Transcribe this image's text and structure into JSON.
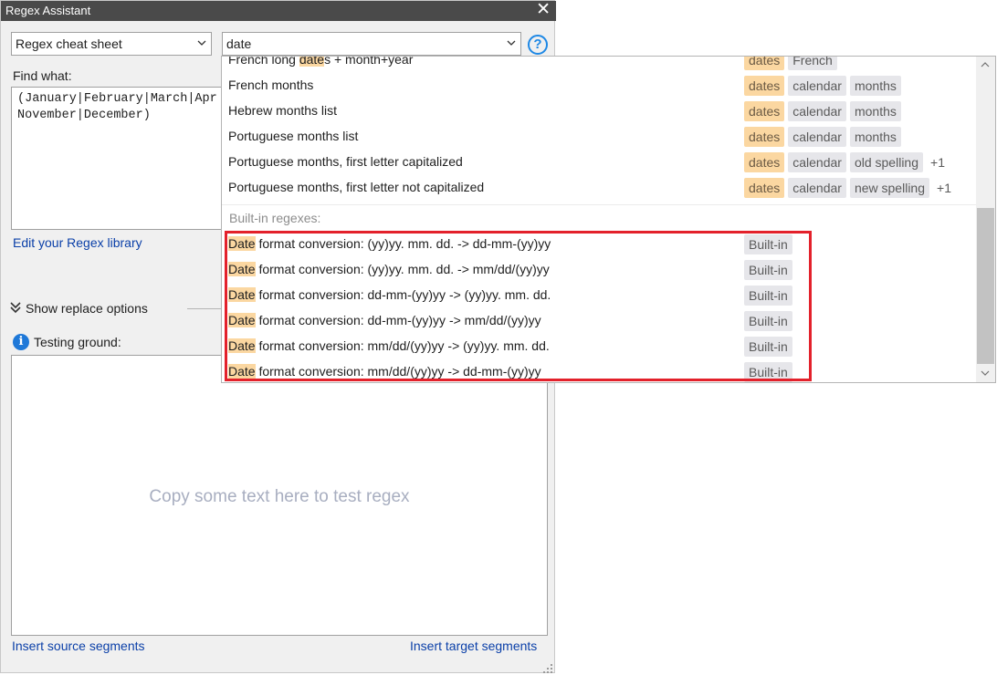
{
  "window": {
    "title": "Regex Assistant"
  },
  "library_select": {
    "value": "Regex cheat sheet"
  },
  "search": {
    "value": "date"
  },
  "find_what": {
    "label": "Find what:",
    "lines": [
      "(January|February|March|Apr",
      "November|December)"
    ]
  },
  "links": {
    "edit_library": "Edit your Regex library",
    "insert_source": "Insert source segments",
    "insert_target": "Insert target segments"
  },
  "replace_toggle": {
    "label": "Show replace options"
  },
  "testing": {
    "label": "Testing ground:",
    "placeholder": "Copy some text here to test regex"
  },
  "dropdown": {
    "partial_row": {
      "pre": "French long ",
      "match": "date",
      "post": "s + month+year",
      "tags": [
        "dates",
        "French"
      ]
    },
    "user_rows": [
      {
        "name": "French months",
        "tags": [
          "dates",
          "calendar",
          "months"
        ],
        "more": ""
      },
      {
        "name": "Hebrew months list",
        "tags": [
          "dates",
          "calendar",
          "months"
        ],
        "more": ""
      },
      {
        "name": "Portuguese months list",
        "tags": [
          "dates",
          "calendar",
          "months"
        ],
        "more": ""
      },
      {
        "name": "Portuguese months, first letter capitalized",
        "tags": [
          "dates",
          "calendar",
          "old spelling"
        ],
        "more": "+1"
      },
      {
        "name": "Portuguese months, first letter not capitalized",
        "tags": [
          "dates",
          "calendar",
          "new spelling"
        ],
        "more": "+1"
      }
    ],
    "builtin_label": "Built-in regexes:",
    "builtin_rows": [
      {
        "match": "Date",
        "rest": " format conversion: (yy)yy. mm. dd. -> dd-mm-(yy)yy",
        "tag": "Built-in"
      },
      {
        "match": "Date",
        "rest": " format conversion: (yy)yy. mm. dd. -> mm/dd/(yy)yy",
        "tag": "Built-in"
      },
      {
        "match": "Date",
        "rest": " format conversion: dd-mm-(yy)yy -> (yy)yy. mm. dd.",
        "tag": "Built-in"
      },
      {
        "match": "Date",
        "rest": " format conversion: dd-mm-(yy)yy -> mm/dd/(yy)yy",
        "tag": "Built-in"
      },
      {
        "match": "Date",
        "rest": " format conversion: mm/dd/(yy)yy -> (yy)yy. mm. dd.",
        "tag": "Built-in"
      },
      {
        "match": "Date",
        "rest": " format conversion: mm/dd/(yy)yy -> dd-mm-(yy)yy",
        "tag": "Built-in"
      }
    ]
  },
  "colors": {
    "highlight_tag": "#fbd7a1",
    "annotation_box": "#e3212b",
    "link": "#0a3fa8"
  }
}
